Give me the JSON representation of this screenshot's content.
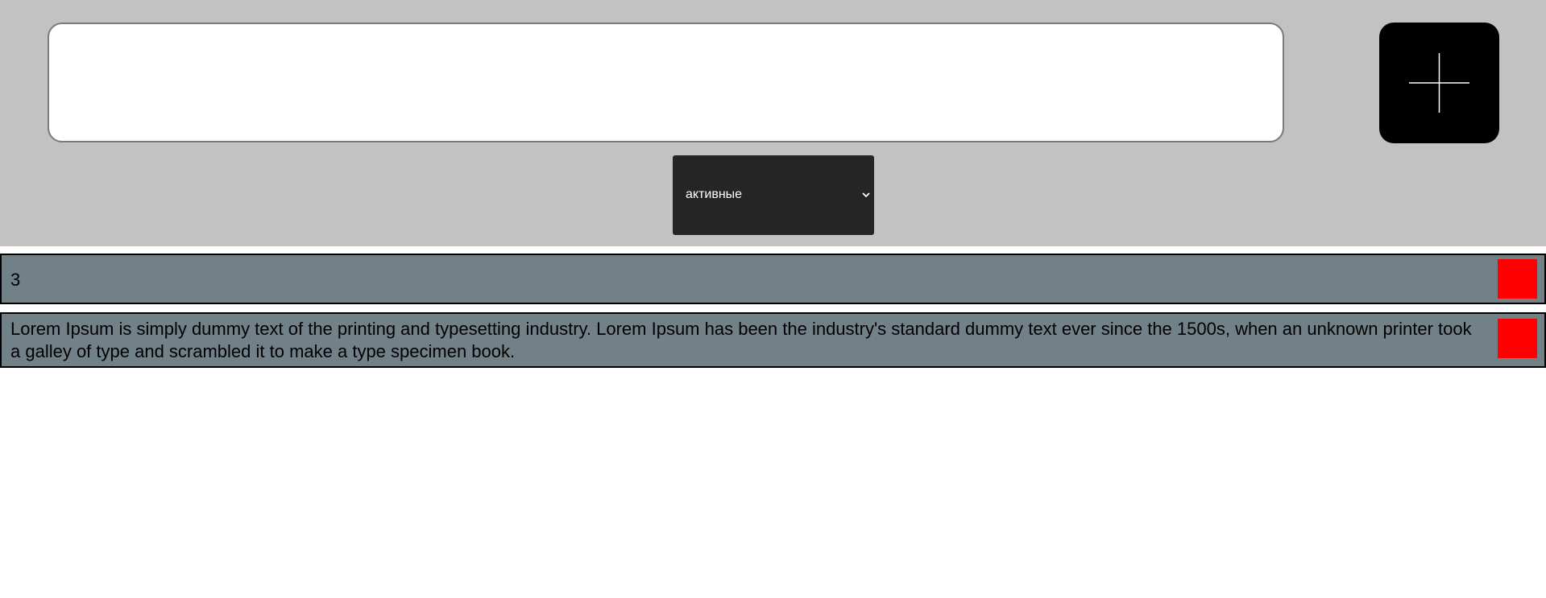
{
  "header": {
    "input": {
      "value": "",
      "placeholder": ""
    },
    "add_button": {
      "icon": "plus-icon"
    },
    "filter": {
      "selected": "активные",
      "icon": "chevron-down-icon"
    }
  },
  "todos": [
    {
      "text": "3"
    },
    {
      "text": "Lorem Ipsum is simply dummy text of the printing and typesetting industry. Lorem Ipsum has been the industry's standard dummy text ever since the 1500s, when an unknown printer took a galley of type and scrambled it to make a type specimen book."
    }
  ],
  "colors": {
    "header_bg": "#c2c2c2",
    "item_bg": "#728087",
    "delete_button": "#ff0000",
    "select_bg": "#252525",
    "add_button_bg": "#000000"
  }
}
